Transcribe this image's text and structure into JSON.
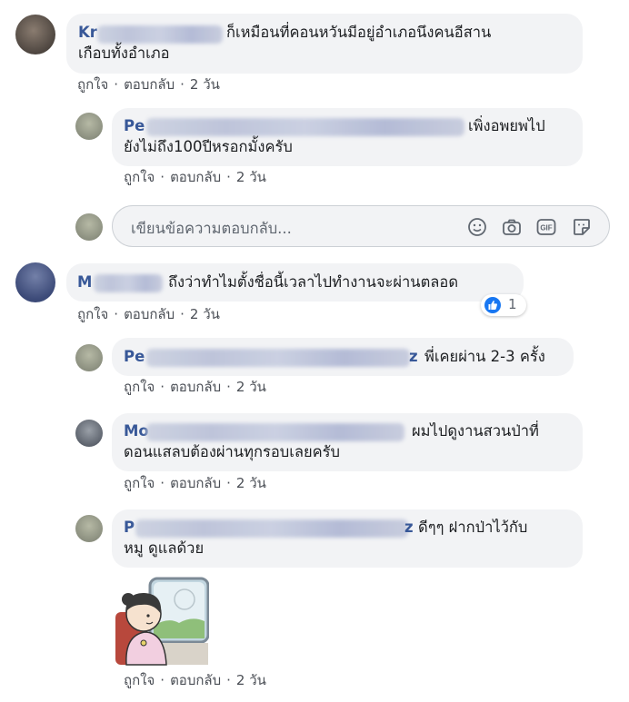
{
  "comments": [
    {
      "name_visible": "Kr",
      "lines": [
        "ก็เหมือนที่คอนหวันมีอยู่อำเภอนึงคนอีสาน",
        "เกือบทั้งอำเภอ"
      ],
      "actions": {
        "like": "ถูกใจ",
        "reply": "ตอบกลับ",
        "time": "2 วัน"
      }
    },
    {
      "name_visible": "Pe",
      "lines": [
        "เพิ่งอพยพไป",
        "ยังไม่ถึง100ปีหรอกมั้งครับ"
      ],
      "actions": {
        "like": "ถูกใจ",
        "reply": "ตอบกลับ",
        "time": "2 วัน"
      }
    },
    {
      "name_visible": "M",
      "lines": [
        "ถึงว่าทำไมตั้งชื่อนี้เวลาไปทำงานจะผ่านตลอด"
      ],
      "reaction_count": "1",
      "actions": {
        "like": "ถูกใจ",
        "reply": "ตอบกลับ",
        "time": "2 วัน"
      }
    },
    {
      "name_visible": "Pe",
      "name_tail": "z",
      "lines": [
        "พี่เคยผ่าน 2-3 ครั้ง"
      ],
      "actions": {
        "like": "ถูกใจ",
        "reply": "ตอบกลับ",
        "time": "2 วัน"
      }
    },
    {
      "name_visible": "Mo",
      "lines": [
        "ผมไปดูงานสวนป่าที่",
        "ดอนแสลบต้องผ่านทุกรอบเลยครับ"
      ],
      "actions": {
        "like": "ถูกใจ",
        "reply": "ตอบกลับ",
        "time": "2 วัน"
      }
    },
    {
      "name_visible": "P",
      "name_tail": "z",
      "lines": [
        "ดีๆๆ ฝากป่าไว้กับ",
        "หมู ดูแลด้วย"
      ],
      "actions": {
        "like": "ถูกใจ",
        "reply": "ตอบกลับ",
        "time": "2 วัน"
      }
    }
  ],
  "reply_box": {
    "placeholder": "เขียนข้อความตอบกลับ...",
    "icons": [
      "emoji-icon",
      "camera-icon",
      "gif-icon",
      "sticker-icon"
    ],
    "gif_label": "GIF"
  },
  "colors": {
    "name": "#385898",
    "bubble": "#f2f3f5",
    "like_blue": "#1877f2",
    "meta": "#4b4f56"
  }
}
